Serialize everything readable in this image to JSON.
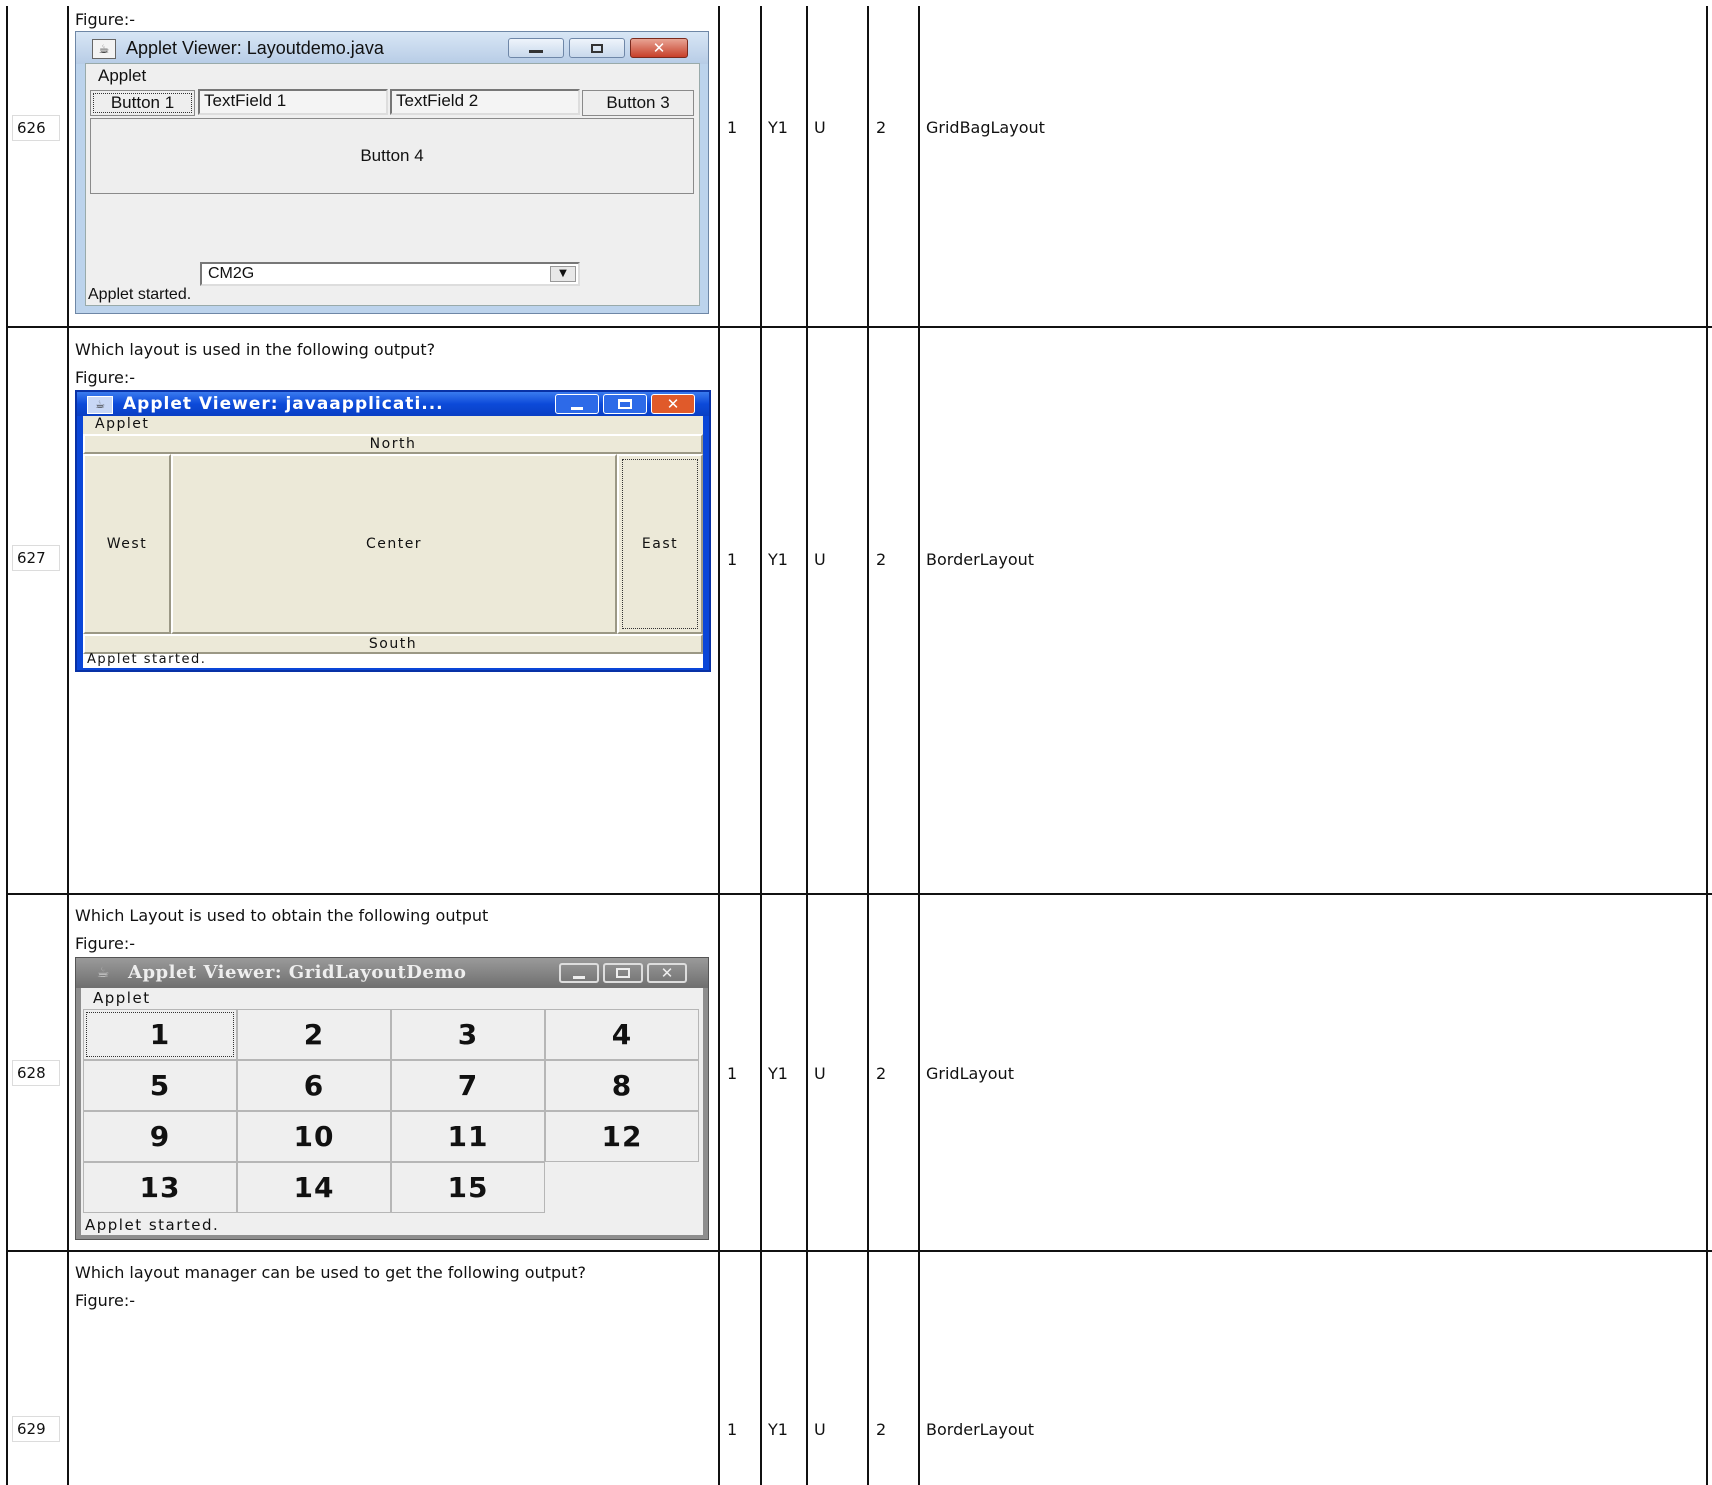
{
  "rows": [
    {
      "id": "626",
      "question": "",
      "figure_label": "Figure:-",
      "col1": "1",
      "col2": "Y1",
      "col3": "U",
      "col4": "2",
      "answer": "GridBagLayout",
      "window": {
        "title": "Applet Viewer: Layoutdemo.java",
        "menu": "Applet",
        "button1": "Button 1",
        "textfield1": "TextField 1",
        "textfield2": "TextField 2",
        "button3": "Button 3",
        "button4": "Button 4",
        "combo_value": "CM2G",
        "status": "Applet started."
      }
    },
    {
      "id": "627",
      "question": "Which layout is used in the following output?",
      "figure_label": "Figure:-",
      "col1": "1",
      "col2": "Y1",
      "col3": "U",
      "col4": "2",
      "answer": "BorderLayout",
      "window": {
        "title": "Applet Viewer: javaapplicati...",
        "menu": "Applet",
        "north": "North",
        "west": "West",
        "center": "Center",
        "east": "East",
        "south": "South",
        "status": "Applet started."
      }
    },
    {
      "id": "628",
      "question": "Which Layout is used to obtain the following output",
      "figure_label": "Figure:-",
      "col1": "1",
      "col2": "Y1",
      "col3": "U",
      "col4": "2",
      "answer": "GridLayout",
      "window": {
        "title": "Applet Viewer: GridLayoutDemo",
        "menu": "Applet",
        "cells": [
          "1",
          "2",
          "3",
          "4",
          "5",
          "6",
          "7",
          "8",
          "9",
          "10",
          "11",
          "12",
          "13",
          "14",
          "15"
        ],
        "status": "Applet started."
      }
    },
    {
      "id": "629",
      "question": "Which layout manager can be used to get the following output?",
      "figure_label": "Figure:-",
      "col1": "1",
      "col2": "Y1",
      "col3": "U",
      "col4": "2",
      "answer": "BorderLayout"
    }
  ]
}
